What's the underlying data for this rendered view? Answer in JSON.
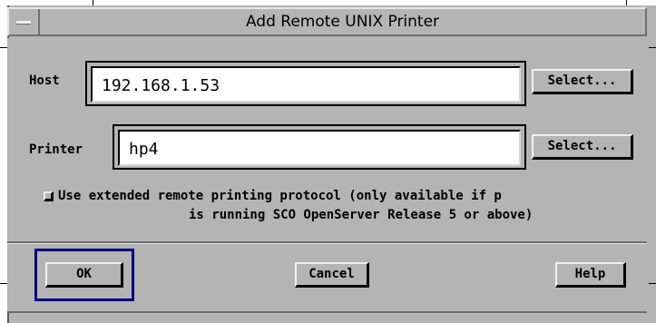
{
  "window": {
    "title": "Add Remote UNIX Printer",
    "menu_icon": "window-menu-icon"
  },
  "host": {
    "label": "Host",
    "value": "192.168.1.53",
    "select_label": "Select..."
  },
  "printer": {
    "label": "Printer",
    "value": "hp4",
    "select_label": "Select..."
  },
  "extended_protocol": {
    "checked": false,
    "line1": "Use extended remote printing protocol (only available if p",
    "line2": "is running SCO OpenServer Release 5 or above)"
  },
  "buttons": {
    "ok": "OK",
    "cancel": "Cancel",
    "help": "Help"
  },
  "colors": {
    "background": "#b4b4b4",
    "default_button_frame": "#00007e",
    "field": "#ffffff"
  }
}
